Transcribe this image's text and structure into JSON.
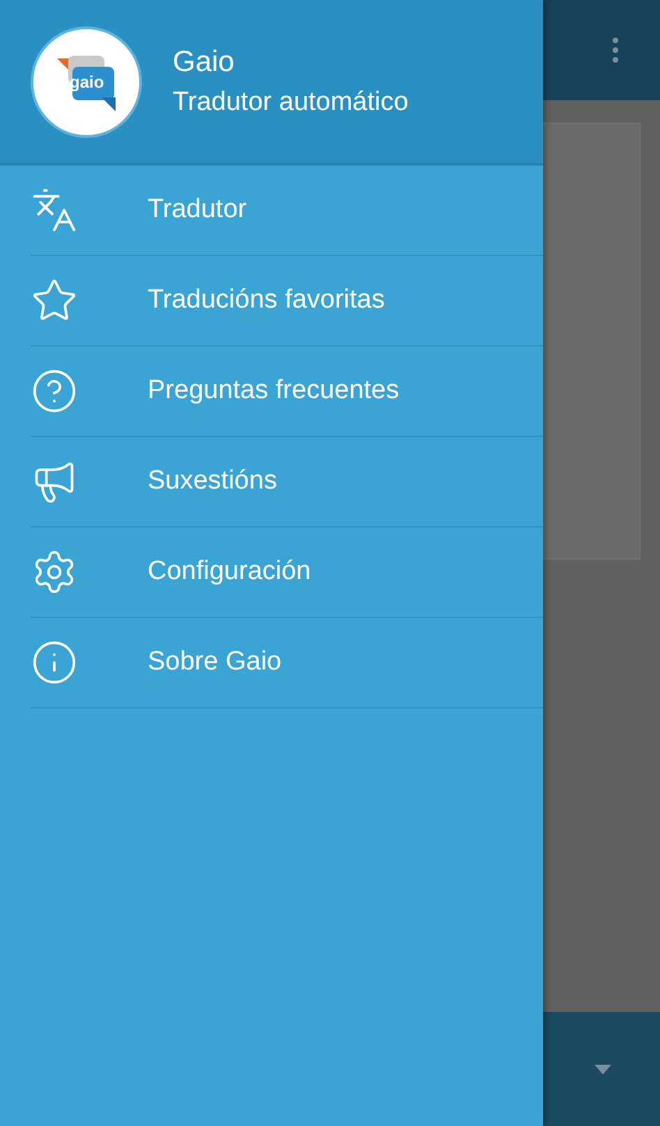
{
  "drawer": {
    "app_name": "Gaio",
    "subtitle": "Tradutor automático",
    "logo_text": "gaio",
    "items": [
      {
        "kind": "translate",
        "label": "Tradutor"
      },
      {
        "kind": "star",
        "label": "Traducións favoritas"
      },
      {
        "kind": "help",
        "label": "Preguntas frecuentes"
      },
      {
        "kind": "megaphone",
        "label": "Suxestións"
      },
      {
        "kind": "settings",
        "label": "Configuración"
      },
      {
        "kind": "info",
        "label": "Sobre Gaio"
      }
    ]
  }
}
